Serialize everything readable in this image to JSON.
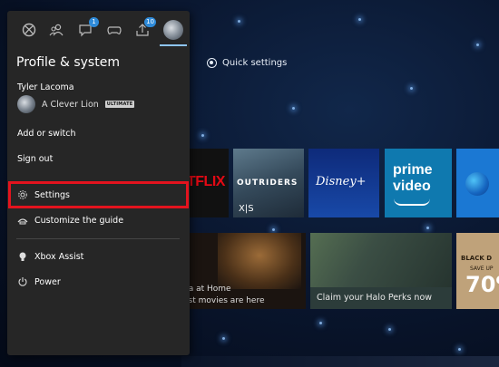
{
  "guide": {
    "tabs": [
      {
        "name": "xbox-home",
        "badge": ""
      },
      {
        "name": "people",
        "badge": ""
      },
      {
        "name": "parties-and-chats",
        "badge": "1"
      },
      {
        "name": "controller",
        "badge": ""
      },
      {
        "name": "upload-capture",
        "badge": "10"
      },
      {
        "name": "profile",
        "badge": ""
      }
    ],
    "title": "Profile & system",
    "profile": {
      "gamertag": "Tyler Lacoma",
      "display_name": "A Clever Lion",
      "badge": "ULTIMATE"
    },
    "items": {
      "add_or_switch": "Add or switch",
      "sign_out": "Sign out",
      "settings": "Settings",
      "customize": "Customize the guide",
      "xbox_assist": "Xbox Assist",
      "power": "Power"
    },
    "highlight_color": "#e3131e"
  },
  "dashboard": {
    "quick_settings": "Quick settings",
    "tiles": {
      "netflix": "TFLIX",
      "outriders_title": "OUTRIDERS",
      "outriders_sub": "X|S",
      "disney": "Disney+",
      "prime": "prime\nvideo",
      "home_caption": "na at Home\nest movies are here",
      "halo_caption": "Claim your Halo Perks now",
      "blackdesert_1": "BLACK D",
      "blackdesert_2": "SAVE UP",
      "blackdesert_3": "70%"
    }
  }
}
